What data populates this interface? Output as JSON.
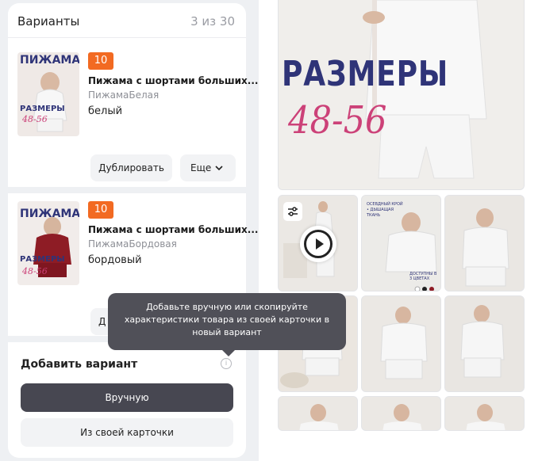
{
  "variants_panel": {
    "title": "Варианты",
    "count": "3 из 30",
    "items": [
      {
        "badge": "10",
        "name": "Пижама с шортами больших...",
        "subtitle": "ПижамаБелая",
        "color": "белый",
        "thumb_text_top": "ПИЖАМА",
        "thumb_text_mid": "РАЗМЕРЫ",
        "thumb_text_num": "48-56",
        "duplicate_label": "Дублировать",
        "more_label": "Еще"
      },
      {
        "badge": "10",
        "name": "Пижама с шортами больших...",
        "subtitle": "ПижамаБордовая",
        "color": "бордовый",
        "thumb_text_top": "ПИЖАМА",
        "thumb_text_mid": "РАЗМЕРЫ",
        "thumb_text_num": "48-56",
        "duplicate_label": "Д"
      }
    ]
  },
  "add_variant": {
    "title": "Добавить вариант",
    "manual_label": "Вручную",
    "from_card_label": "Из своей карточки"
  },
  "tooltip": {
    "text": "Добавьте вручную или скопируйте характеристики товара из своей карточки в новый вариант"
  },
  "gallery": {
    "hero_line1": "РАЗМЕРЫ",
    "hero_line2": "48-56",
    "caption_1": "ОСЕВДНЫЙ КРОЙ\n• ДЫШАЩАЯ ТКАНЬ",
    "caption_2": "ДОСТУПНЫ В 3 ЦВЕТАХ"
  },
  "colors": {
    "accent_badge": "#f26a22",
    "primary_button": "#474751",
    "hero_blue": "#2f3478",
    "hero_pink": "#cc4178"
  }
}
